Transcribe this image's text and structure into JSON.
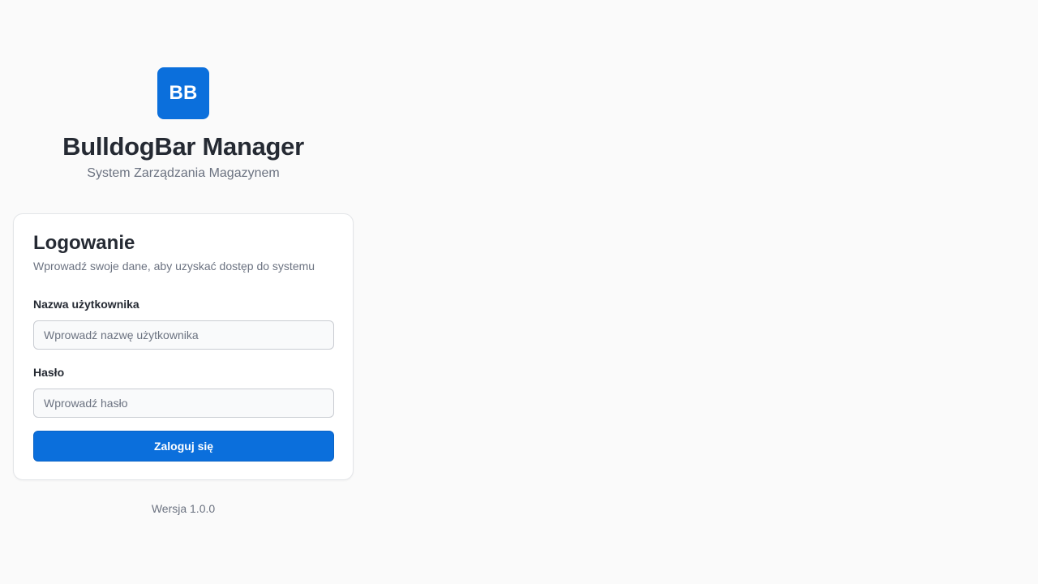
{
  "brand": {
    "logo_text": "BB",
    "title": "BulldogBar Manager",
    "subtitle": "System Zarządzania Magazynem"
  },
  "login": {
    "title": "Logowanie",
    "description": "Wprowadź swoje dane, aby uzyskać dostęp do systemu",
    "username": {
      "label": "Nazwa użytkownika",
      "placeholder": "Wprowadź nazwę użytkownika",
      "value": ""
    },
    "password": {
      "label": "Hasło",
      "placeholder": "Wprowadź hasło",
      "value": ""
    },
    "submit_label": "Zaloguj się"
  },
  "footer": {
    "version": "Wersja 1.0.0"
  },
  "colors": {
    "accent": "#0b6fdc",
    "background": "#fafafa",
    "text_primary": "#252a33",
    "text_muted": "#6b7280"
  }
}
